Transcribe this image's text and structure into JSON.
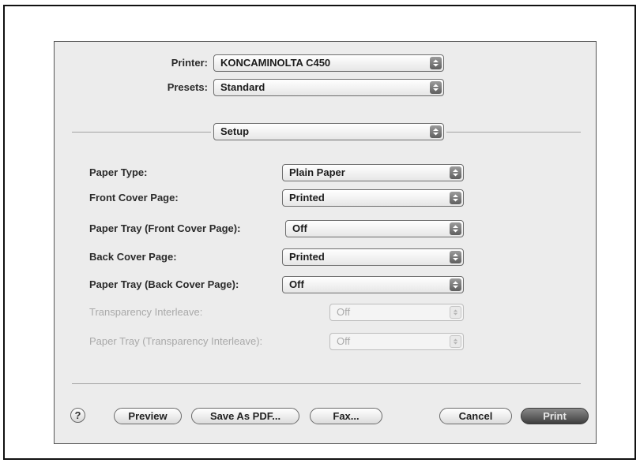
{
  "printer": {
    "label": "Printer:",
    "value": "KONCAMINOLTA C450"
  },
  "presets": {
    "label": "Presets:",
    "value": "Standard"
  },
  "panel": {
    "value": "Setup"
  },
  "settings": [
    {
      "label": "Paper Type:",
      "value": "Plain Paper",
      "enabled": true
    },
    {
      "label": "Front Cover Page:",
      "value": "Printed",
      "enabled": true
    },
    {
      "label": "Paper Tray (Front Cover Page):",
      "value": "Off",
      "enabled": true
    },
    {
      "label": "Back Cover Page:",
      "value": "Printed",
      "enabled": true
    },
    {
      "label": "Paper Tray (Back Cover Page):",
      "value": "Off",
      "enabled": true
    },
    {
      "label": "Transparency Interleave:",
      "value": "Off",
      "enabled": false
    },
    {
      "label": "Paper Tray (Transparency Interleave):",
      "value": "Off",
      "enabled": false
    }
  ],
  "buttons": {
    "help": "?",
    "preview": "Preview",
    "save_pdf": "Save As PDF...",
    "fax": "Fax...",
    "cancel": "Cancel",
    "print": "Print"
  },
  "icons": {
    "popup_arrow": "updown-chevron-icon",
    "help": "question-mark-icon"
  }
}
